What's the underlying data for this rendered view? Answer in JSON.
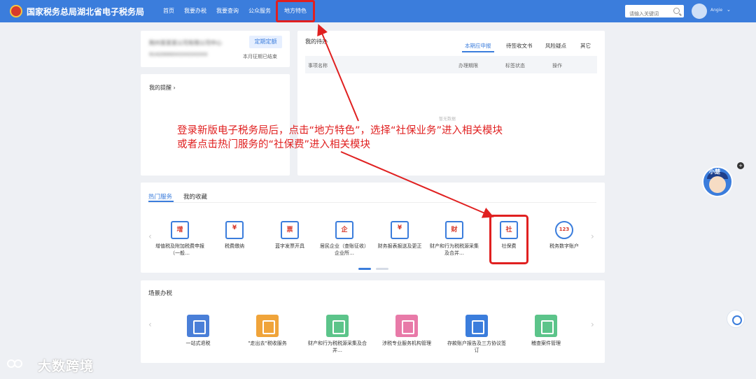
{
  "header": {
    "site_title": "国家税务总局湖北省电子税务局",
    "nav": [
      "首页",
      "我要办税",
      "我要查询",
      "公众服务",
      "地方特色"
    ],
    "search_placeholder": "请输入关键词",
    "username": "Angie",
    "brand_color": "#3b7ddc",
    "highlight_color": "#e02020"
  },
  "company": {
    "name": "荆州某某某公司有限公司中心",
    "id": "91420000XXXXXXXXXX",
    "tax_button": "定期定额",
    "period_status": "本月征期已结束"
  },
  "reminder": {
    "title": "我的提醒 ›"
  },
  "todo": {
    "title": "我的待办",
    "tabs": [
      "本期应申报",
      "待签收文书",
      "风险疑点",
      "其它"
    ],
    "columns": [
      "事项名称",
      "办理期限",
      "标签状态",
      "操作"
    ],
    "empty_text": "暂无数据"
  },
  "annotation": {
    "line1": "登录新版电子税务局后，点击“地方特色”，选择“社保业务”进入相关模块",
    "line2": "或者点击热门服务的“社保费”进入相关模块"
  },
  "hot": {
    "tabs": [
      "热门服务",
      "我的收藏"
    ],
    "items": [
      {
        "label": "增值税及附加税费申报（一般…",
        "glyph": "增"
      },
      {
        "label": "税费缴纳",
        "glyph": "¥"
      },
      {
        "label": "蓝字发票开具",
        "glyph": "票"
      },
      {
        "label": "居民企业（查账征收）企业所…",
        "glyph": "企"
      },
      {
        "label": "财务报表报送及更正",
        "glyph": "¥"
      },
      {
        "label": "财产和行为税税源采集及合并…",
        "glyph": "财"
      },
      {
        "label": "社保费",
        "glyph": "社"
      },
      {
        "label": "税务数字账户",
        "glyph": "123"
      }
    ]
  },
  "scene": {
    "title": "场景办税",
    "items": [
      {
        "label": "一站式退税",
        "color": "#4a7fd8"
      },
      {
        "label": "\"走出去\"税收服务",
        "color": "#f0a43a"
      },
      {
        "label": "财产和行为税税源采集及合并…",
        "color": "#5cc48a"
      },
      {
        "label": "涉税专业服务机构管理",
        "color": "#e87aa8"
      },
      {
        "label": "存款账户报告及三方协议签订",
        "color": "#3b7ddc"
      },
      {
        "label": "稽查案件管理",
        "color": "#5cc48a"
      }
    ]
  },
  "mascot": {
    "label": "小楚"
  },
  "watermark": "大数跨境"
}
